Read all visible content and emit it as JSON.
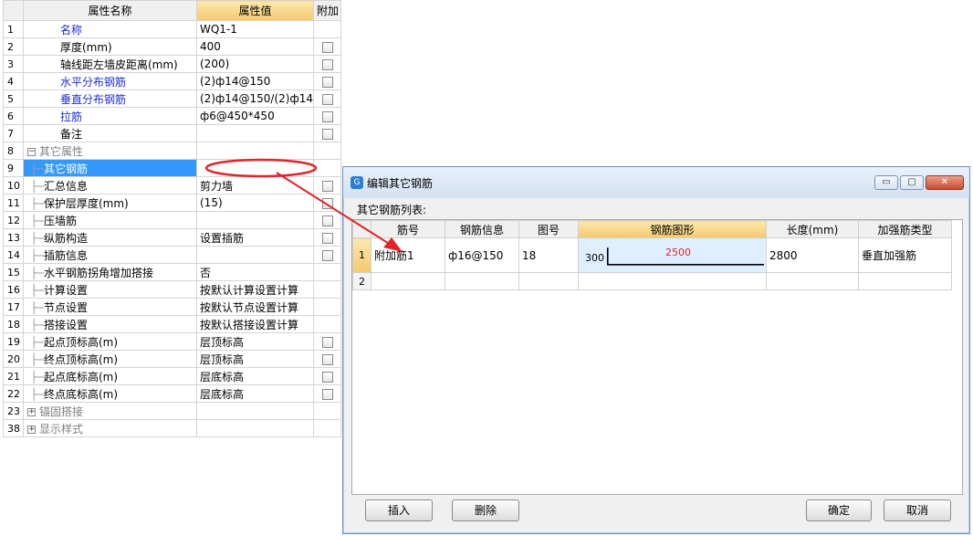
{
  "props": {
    "header": {
      "rownum": "",
      "name": "属性名称",
      "value": "属性值",
      "extra": "附加"
    },
    "rows": [
      {
        "n": "1",
        "name": "名称",
        "value": "WQ1-1",
        "cb": false,
        "color": "blue",
        "level": 0
      },
      {
        "n": "2",
        "name": "厚度(mm)",
        "value": "400",
        "cb": true,
        "color": "black",
        "level": 0
      },
      {
        "n": "3",
        "name": "轴线距左墙皮距离(mm)",
        "value": "(200)",
        "cb": true,
        "color": "black",
        "level": 0
      },
      {
        "n": "4",
        "name": "水平分布钢筋",
        "value": "(2)ф14@150",
        "cb": true,
        "color": "blue",
        "level": 0
      },
      {
        "n": "5",
        "name": "垂直分布钢筋",
        "value": "(2)ф14@150/(2)ф14",
        "cb": true,
        "color": "blue",
        "level": 0
      },
      {
        "n": "6",
        "name": "拉筋",
        "value": "ф6@450*450",
        "cb": true,
        "color": "blue",
        "level": 0
      },
      {
        "n": "7",
        "name": "备注",
        "value": "",
        "cb": true,
        "color": "black",
        "level": 0
      },
      {
        "n": "8",
        "name": "其它属性",
        "value": "",
        "cb": false,
        "color": "gray",
        "level": -1,
        "expander": "−"
      },
      {
        "n": "9",
        "name": "其它钢筋",
        "value": "",
        "cb": false,
        "color": "black",
        "level": 1,
        "selected": true
      },
      {
        "n": "10",
        "name": "汇总信息",
        "value": "剪力墙",
        "cb": true,
        "color": "black",
        "level": 1
      },
      {
        "n": "11",
        "name": "保护层厚度(mm)",
        "value": "(15)",
        "cb": true,
        "color": "black",
        "level": 1
      },
      {
        "n": "12",
        "name": "压墙筋",
        "value": "",
        "cb": true,
        "color": "black",
        "level": 1
      },
      {
        "n": "13",
        "name": "纵筋构造",
        "value": "设置插筋",
        "cb": true,
        "color": "black",
        "level": 1
      },
      {
        "n": "14",
        "name": "插筋信息",
        "value": "",
        "cb": true,
        "color": "black",
        "level": 1
      },
      {
        "n": "15",
        "name": "水平钢筋拐角增加搭接",
        "value": "否",
        "cb": false,
        "color": "black",
        "level": 1
      },
      {
        "n": "16",
        "name": "计算设置",
        "value": "按默认计算设置计算",
        "cb": false,
        "color": "black",
        "level": 1
      },
      {
        "n": "17",
        "name": "节点设置",
        "value": "按默认节点设置计算",
        "cb": false,
        "color": "black",
        "level": 1
      },
      {
        "n": "18",
        "name": "搭接设置",
        "value": "按默认搭接设置计算",
        "cb": false,
        "color": "black",
        "level": 1
      },
      {
        "n": "19",
        "name": "起点顶标高(m)",
        "value": "层顶标高",
        "cb": true,
        "color": "black",
        "level": 1
      },
      {
        "n": "20",
        "name": "终点顶标高(m)",
        "value": "层顶标高",
        "cb": true,
        "color": "black",
        "level": 1
      },
      {
        "n": "21",
        "name": "起点底标高(m)",
        "value": "层底标高",
        "cb": true,
        "color": "black",
        "level": 1
      },
      {
        "n": "22",
        "name": "终点底标高(m)",
        "value": "层底标高",
        "cb": true,
        "color": "black",
        "level": 1
      },
      {
        "n": "23",
        "name": "锚固搭接",
        "value": "",
        "cb": false,
        "color": "gray",
        "level": -1,
        "expander": "+"
      },
      {
        "n": "38",
        "name": "显示样式",
        "value": "",
        "cb": false,
        "color": "gray",
        "level": -1,
        "expander": "+"
      }
    ]
  },
  "dialog": {
    "title": "编辑其它钢筋",
    "list_label": "其它钢筋列表:",
    "columns": [
      "",
      "筋号",
      "钢筋信息",
      "图号",
      "钢筋图形",
      "长度(mm)",
      "加强筋类型"
    ],
    "rows": [
      {
        "n": "1",
        "name": "附加筋1",
        "info": "ф16@150",
        "fig": "18",
        "shape_left": "300",
        "shape_top": "2500",
        "length": "2800",
        "type": "垂直加强筋"
      },
      {
        "n": "2",
        "name": "",
        "info": "",
        "fig": "",
        "shape_left": "",
        "shape_top": "",
        "length": "",
        "type": ""
      }
    ],
    "buttons": {
      "insert": "插入",
      "delete": "删除",
      "ok": "确定",
      "cancel": "取消"
    },
    "window_buttons": {
      "minimize": "▭",
      "restore": "▢",
      "close": "✕"
    }
  },
  "colors": {
    "annotation": "#e0242a",
    "selection": "#3399ff",
    "header_highlight": "#f5c96c",
    "link_blue": "#1c2fcf"
  }
}
